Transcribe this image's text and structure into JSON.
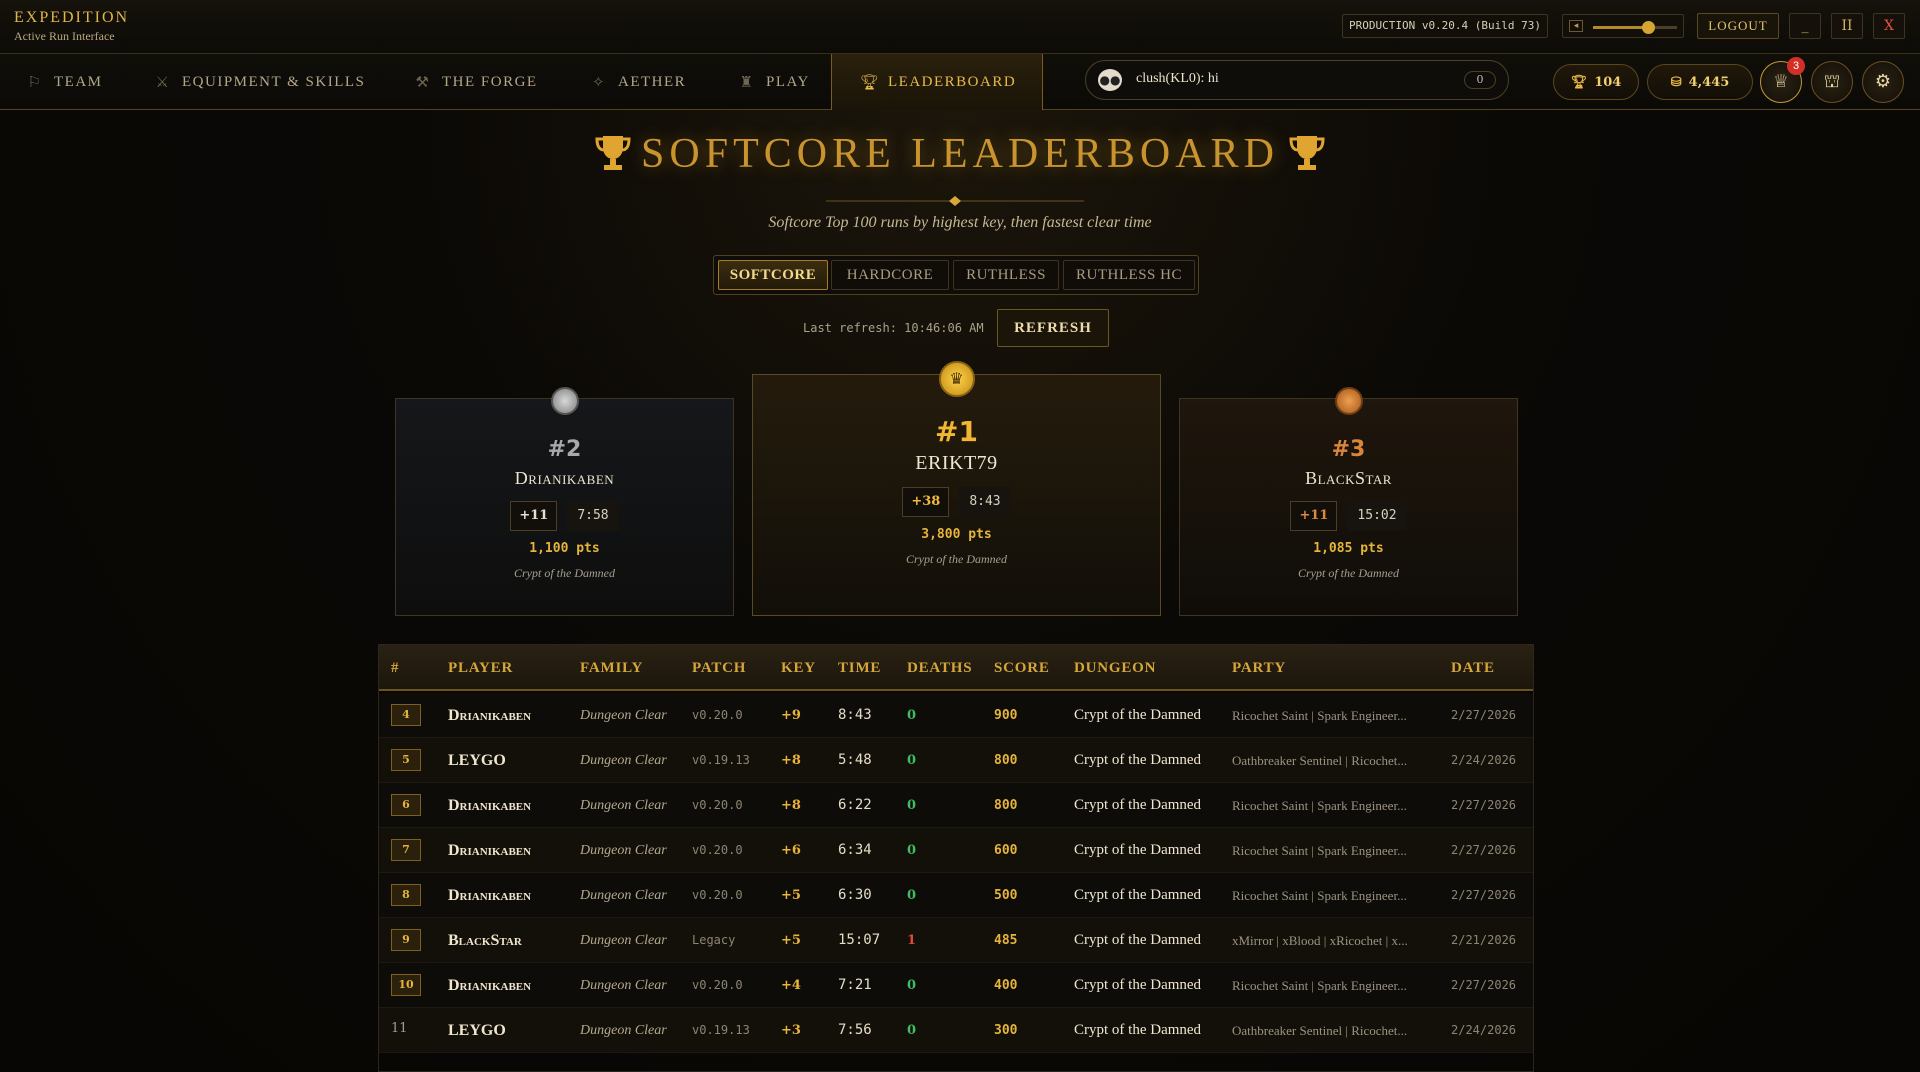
{
  "app": {
    "title": "EXPEDITION",
    "subtitle": "Active Run Interface"
  },
  "topbar": {
    "version": "PRODUCTION v0.20.4 (Build 73)",
    "volume_level": 0.66,
    "logout_label": "LOGOUT",
    "minimize_label": "_",
    "pause_label": "II",
    "close_label": "X"
  },
  "nav": {
    "tabs": [
      {
        "label": "TEAM",
        "icon": "runner-icon",
        "active": false
      },
      {
        "label": "EQUIPMENT & SKILLS",
        "icon": "crossed-swords-icon",
        "active": false
      },
      {
        "label": "THE FORGE",
        "icon": "anvil-icon",
        "active": false
      },
      {
        "label": "AETHER",
        "icon": "aether-icon",
        "active": false
      },
      {
        "label": "PLAY",
        "icon": "castle-icon",
        "active": false
      },
      {
        "label": "LEADERBOARD",
        "icon": "trophy-icon",
        "active": true
      }
    ],
    "chat": {
      "message": "clush(KL0): hi",
      "count": "0"
    },
    "trophies": "104",
    "gold": "4,445",
    "notification_count": "3"
  },
  "page": {
    "title": "SOFTCORE LEADERBOARD",
    "subtitle": "Softcore Top 100 runs by highest key, then fastest clear time",
    "modes": [
      {
        "label": "SOFTCORE",
        "active": true
      },
      {
        "label": "HARDCORE",
        "active": false
      },
      {
        "label": "RUTHLESS",
        "active": false
      },
      {
        "label": "RUTHLESS HC",
        "active": false
      }
    ],
    "last_refresh": "Last refresh: 10:46:06 AM",
    "refresh_label": "REFRESH"
  },
  "podium": {
    "first": {
      "rank": "#1",
      "player": "ERIKT79",
      "key": "+38",
      "time": "8:43",
      "pts": "3,800 pts",
      "dungeon": "Crypt of the Damned"
    },
    "second": {
      "rank": "#2",
      "player": "Drianikaben",
      "key": "+11",
      "time": "7:58",
      "pts": "1,100 pts",
      "dungeon": "Crypt of the Damned"
    },
    "third": {
      "rank": "#3",
      "player": "BlackStar",
      "key": "+11",
      "time": "15:02",
      "pts": "1,085 pts",
      "dungeon": "Crypt of the Damned"
    }
  },
  "table": {
    "headers": {
      "rank": "#",
      "player": "PLAYER",
      "family": "FAMILY",
      "patch": "PATCH",
      "key": "KEY",
      "time": "TIME",
      "deaths": "DEATHS",
      "score": "SCORE",
      "dungeon": "DUNGEON",
      "party": "PARTY",
      "date": "DATE"
    },
    "rows": [
      {
        "rank": "4",
        "player": "Drianikaben",
        "family": "Dungeon Clear",
        "patch": "v0.20.0",
        "key": "+9",
        "time": "8:43",
        "deaths": "0",
        "score": "900",
        "dungeon": "Crypt of the Damned",
        "party": "Ricochet Saint | Spark Engineer...",
        "date": "2/27/2026",
        "badge": true
      },
      {
        "rank": "5",
        "player": "LEYGO",
        "family": "Dungeon Clear",
        "patch": "v0.19.13",
        "key": "+8",
        "time": "5:48",
        "deaths": "0",
        "score": "800",
        "dungeon": "Crypt of the Damned",
        "party": "Oathbreaker Sentinel | Ricochet...",
        "date": "2/24/2026",
        "badge": true
      },
      {
        "rank": "6",
        "player": "Drianikaben",
        "family": "Dungeon Clear",
        "patch": "v0.20.0",
        "key": "+8",
        "time": "6:22",
        "deaths": "0",
        "score": "800",
        "dungeon": "Crypt of the Damned",
        "party": "Ricochet Saint | Spark Engineer...",
        "date": "2/27/2026",
        "badge": true
      },
      {
        "rank": "7",
        "player": "Drianikaben",
        "family": "Dungeon Clear",
        "patch": "v0.20.0",
        "key": "+6",
        "time": "6:34",
        "deaths": "0",
        "score": "600",
        "dungeon": "Crypt of the Damned",
        "party": "Ricochet Saint | Spark Engineer...",
        "date": "2/27/2026",
        "badge": true
      },
      {
        "rank": "8",
        "player": "Drianikaben",
        "family": "Dungeon Clear",
        "patch": "v0.20.0",
        "key": "+5",
        "time": "6:30",
        "deaths": "0",
        "score": "500",
        "dungeon": "Crypt of the Damned",
        "party": "Ricochet Saint | Spark Engineer...",
        "date": "2/27/2026",
        "badge": true
      },
      {
        "rank": "9",
        "player": "BlackStar",
        "family": "Dungeon Clear",
        "patch": "Legacy",
        "key": "+5",
        "time": "15:07",
        "deaths": "1",
        "score": "485",
        "dungeon": "Crypt of the Damned",
        "party": "xMirror | xBlood | xRicochet | x...",
        "date": "2/21/2026",
        "badge": true
      },
      {
        "rank": "10",
        "player": "Drianikaben",
        "family": "Dungeon Clear",
        "patch": "v0.20.0",
        "key": "+4",
        "time": "7:21",
        "deaths": "0",
        "score": "400",
        "dungeon": "Crypt of the Damned",
        "party": "Ricochet Saint | Spark Engineer...",
        "date": "2/27/2026",
        "badge": true
      },
      {
        "rank": "11",
        "player": "LEYGO",
        "family": "Dungeon Clear",
        "patch": "v0.19.13",
        "key": "+3",
        "time": "7:56",
        "deaths": "0",
        "score": "300",
        "dungeon": "Crypt of the Damned",
        "party": "Oathbreaker Sentinel | Ricochet...",
        "date": "2/24/2026",
        "badge": false
      }
    ]
  },
  "colors": {
    "accent": "#e5b43c",
    "deaths_zero": "#3fbf62",
    "deaths_nonzero": "#e04a3a",
    "silver": "#b5b5b5",
    "bronze": "#d88a3a"
  }
}
